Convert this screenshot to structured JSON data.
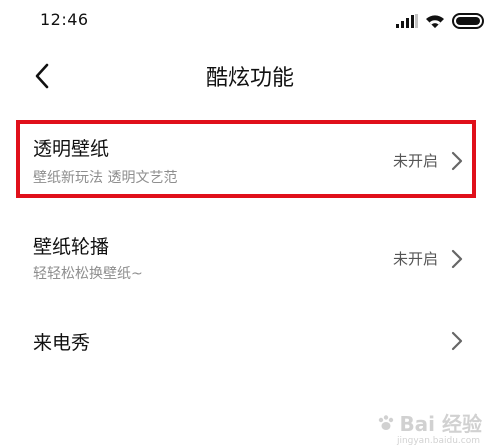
{
  "status_bar": {
    "time": "12:46",
    "icons": [
      "signal-icon",
      "wifi-icon",
      "battery-icon"
    ]
  },
  "header": {
    "back_icon": "chevron-left-icon",
    "title": "酷炫功能"
  },
  "settings": [
    {
      "title": "透明壁纸",
      "subtitle": "壁纸新玩法 透明文艺范",
      "status": "未开启",
      "highlighted": true
    },
    {
      "title": "壁纸轮播",
      "subtitle": "轻轻松松换壁纸~",
      "status": "未开启",
      "highlighted": false
    },
    {
      "title": "来电秀",
      "subtitle": "",
      "status": "",
      "highlighted": false
    }
  ],
  "colors": {
    "highlight_border": "#e0101a",
    "subtitle": "#8e8e8e",
    "status_text": "#555555"
  },
  "watermark": {
    "text": "Bai 经验",
    "sub": "jingyan.baidu.com"
  }
}
